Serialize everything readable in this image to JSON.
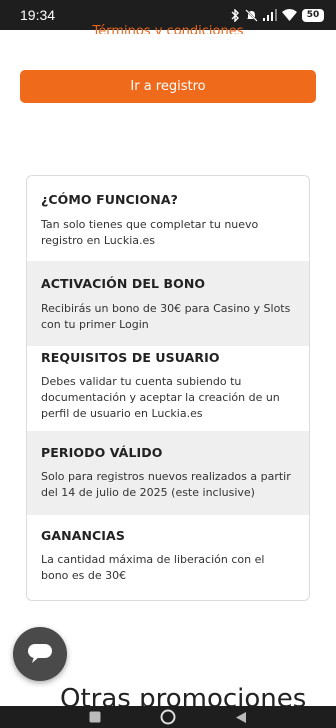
{
  "status_bar": {
    "time": "19:34",
    "battery": "50",
    "icons": [
      "bluetooth-icon",
      "mute-icon",
      "signal-icon",
      "wifi-icon",
      "battery-icon"
    ]
  },
  "cut_text": "Términos y condiciones",
  "cta": {
    "label": "Ir a registro"
  },
  "info_sections": [
    {
      "title": "¿CÓMO FUNCIONA?",
      "text": "Tan solo tienes que completar tu nuevo registro en Luckia.es"
    },
    {
      "title": "ACTIVACIÓN DEL BONO",
      "text": "Recibirás un bono de 30€ para Casino y Slots con tu primer Login"
    },
    {
      "title": "REQUISITOS DE USUARIO",
      "text": "Debes validar tu cuenta subiendo tu documentación y aceptar la creación de un perfil de usuario en Luckia.es"
    },
    {
      "title": "PERIODO VÁLIDO",
      "text": "Solo para registros nuevos realizados a partir del 14 de julio de 2025 (este inclusive)"
    },
    {
      "title": "GANANCIAS",
      "text": "La cantidad máxima de liberación con el bono es de 30€"
    }
  ],
  "chat_button": {
    "icon": "chat-bubble-icon"
  },
  "bottom_heading": "Otras promociones",
  "nav": {
    "icons": [
      "recents-icon",
      "home-icon",
      "back-icon"
    ]
  },
  "colors": {
    "accent": "#f06a1c",
    "shaded": "#efefef",
    "system_bar": "#1e1e1e"
  }
}
